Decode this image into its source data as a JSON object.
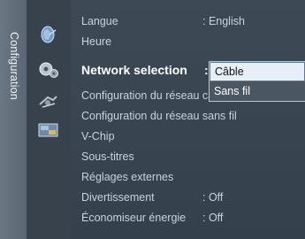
{
  "sidebar": {
    "title": "Configuration",
    "icons": [
      "satellite-dish-icon",
      "gear-icon",
      "network-icon",
      "screen-icon"
    ]
  },
  "menu": {
    "items": [
      {
        "label": "Langue",
        "value": ": English"
      },
      {
        "label": "Heure",
        "value": ""
      },
      {
        "label": "Network selection",
        "value": ":"
      },
      {
        "label": "Configuration du réseau câble",
        "value": ""
      },
      {
        "label": "Configuration du réseau sans fil",
        "value": ""
      },
      {
        "label": "V-Chip",
        "value": ""
      },
      {
        "label": "Sous-titres",
        "value": ""
      },
      {
        "label": "Réglages externes",
        "value": ""
      },
      {
        "label": "Divertissement",
        "value": ": Off"
      },
      {
        "label": "Économiseur énergie",
        "value": ": Off"
      }
    ]
  },
  "dropdown": {
    "options": [
      "Câble",
      "Sans fil"
    ],
    "selected": "Câble"
  },
  "colors": {
    "background": "#3d4955",
    "sidebar_tab": "#6a7682",
    "highlight": "#e6eef7",
    "text": "#c9d3dc",
    "active_text": "#ffffff"
  }
}
